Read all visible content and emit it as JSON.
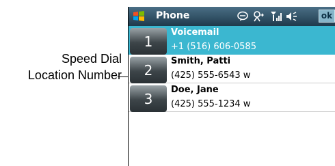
{
  "callout": {
    "line1": "Speed Dial",
    "line2": "Location Number"
  },
  "titlebar": {
    "app_title": "Phone",
    "ok_label": "ok",
    "icons": [
      "windows-logo-icon",
      "speech-bubble-icon",
      "connectivity-icon",
      "signal-icon",
      "speaker-icon"
    ]
  },
  "speed_dial": [
    {
      "slot": "1",
      "name": "Voicemail",
      "number": "+1 (516) 606-0585",
      "selected": true
    },
    {
      "slot": "2",
      "name": "Smith, Patti",
      "number": "(425) 555-6543 w",
      "selected": false
    },
    {
      "slot": "3",
      "name": "Doe, Jane",
      "number": "(425) 555-1234 w",
      "selected": false
    }
  ],
  "colors": {
    "selection": "#3bb7d0",
    "titlebar": "#1f3a4c"
  }
}
